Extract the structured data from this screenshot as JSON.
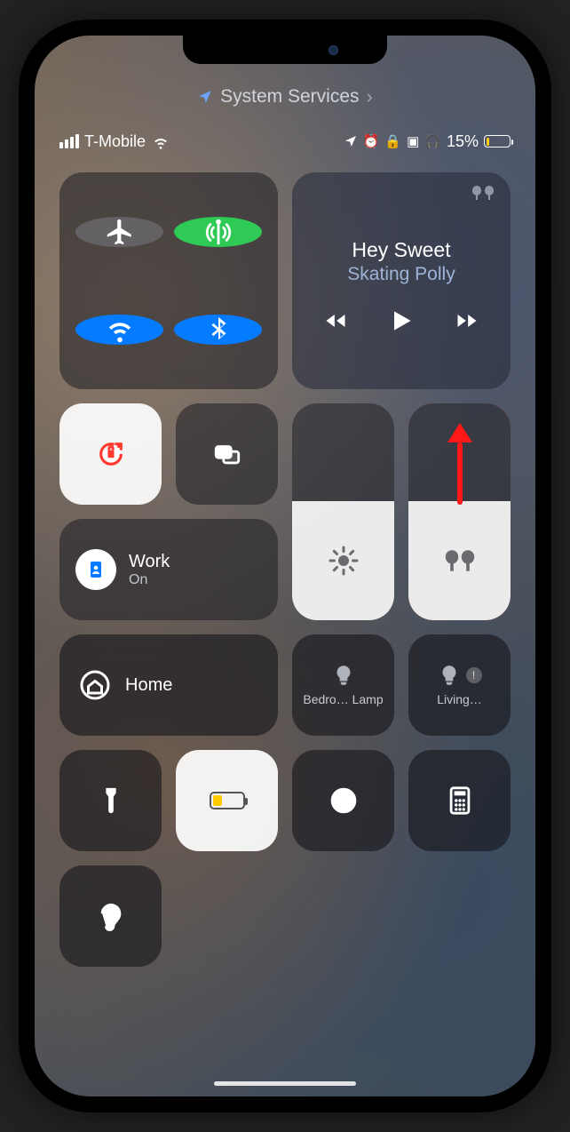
{
  "breadcrumb": {
    "label": "System Services"
  },
  "status": {
    "carrier": "T-Mobile",
    "battery_pct": "15%"
  },
  "media": {
    "title": "Hey Sweet",
    "artist": "Skating Polly"
  },
  "focus": {
    "name": "Work",
    "state": "On"
  },
  "home": {
    "label": "Home"
  },
  "accessories": {
    "a1": "Bedro… Lamp",
    "a2": "Living…"
  },
  "icons": {
    "location": "location-arrow-icon",
    "chevron": "chevron-right-icon",
    "wifi": "wifi-icon",
    "alarm": "alarm-icon",
    "lock_rotation": "rotation-lock-icon",
    "shortcut": "shortcut-icon",
    "headphones": "headphones-icon"
  },
  "colors": {
    "accent_blue": "#0a7aff",
    "accent_green": "#34c759",
    "highlight_red": "#ff1a1a",
    "battery_yellow": "#ffcc00"
  }
}
